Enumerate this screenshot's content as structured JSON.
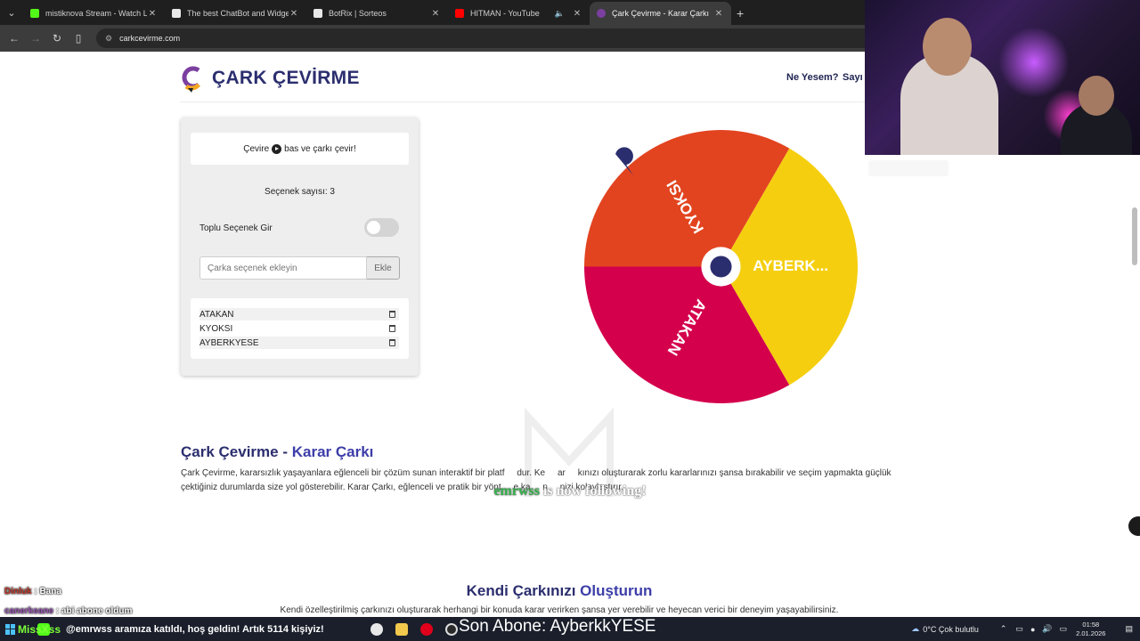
{
  "browser": {
    "tabs": [
      {
        "title": "mistiknova Stream - Watch Live",
        "favicon_color": "#53fc18",
        "active": false,
        "audio": false
      },
      {
        "title": "The best ChatBot and Widgets",
        "favicon_color": "#e8e8e8",
        "active": false,
        "audio": false
      },
      {
        "title": "BotRix | Sorteos",
        "favicon_color": "#e8e8e8",
        "active": false,
        "audio": false
      },
      {
        "title": "HITMAN - YouTube",
        "favicon_color": "#ff0000",
        "active": false,
        "audio": true
      },
      {
        "title": "Çark Çevirme - Karar Çarkı",
        "favicon_color": "#7b3fa0",
        "active": true,
        "audio": false
      }
    ],
    "new_tab_glyph": "+",
    "url": "carkcevirme.com"
  },
  "site": {
    "brand": "ÇARK ÇEVİRME",
    "nav": [
      "Ne Yesem?",
      "Sayı"
    ]
  },
  "panel": {
    "instruction_before": "Çevire",
    "instruction_after": "bas ve çarkı çevir!",
    "option_count_label": "Seçenek sayısı: 3",
    "bulk_label": "Toplu Seçenek Gir",
    "bulk_enabled": false,
    "input_placeholder": "Çarka seçenek ekleyin",
    "add_button": "Ekle",
    "options": [
      "ATAKAN",
      "KYOKSI",
      "AYBERKYESE"
    ]
  },
  "wheel": {
    "segments": [
      {
        "label": "AYBERK...",
        "color": "#f5cf0f"
      },
      {
        "label": "ATAKAN",
        "color": "#d4004c"
      },
      {
        "label": "KYOKSI",
        "color": "#e24420"
      }
    ],
    "center_color": "#2b2e6e",
    "pointer_color": "#2b2e6e"
  },
  "content": {
    "heading1_a": "Çark Çevirme - ",
    "heading1_b": "Karar Çarkı",
    "paragraph1_line1": "Çark Çevirme, kararsızlık yaşayanlara eğlenceli bir çözüm sunan interaktif bir platf     dur. Ke     ar     kınızı oluşturarak zorlu kararlarınızı şansa bırakabilir ve seçim yapmakta güçlük",
    "paragraph1_line2": "çektiğiniz durumlarda size yol gösterebilir. Karar Çarkı, eğlenceli ve pratik bir yönt     e ka     n     nizi kolaylaştırır.",
    "heading2_a": "Kendi Çarkınızı ",
    "heading2_b": "Oluşturun",
    "paragraph2": "Kendi özelleştirilmiş çarkınızı oluşturarak herhangi bir konuda karar verirken şansa yer verebilir ve heyecan verici bir deneyim yaşayabilirsiniz."
  },
  "overlay": {
    "follow_name": "emrwss",
    "follow_text": " is now following!",
    "chat": [
      {
        "user": "Dinluk",
        "text": " : Bana"
      },
      {
        "user": "canerkeane",
        "text": " : abi abone oldum"
      }
    ],
    "ticker_user": "MissXss",
    "ticker": "@emrwss aramıza katıldı, hoş geldin! Artık 5114 kişiyiz!",
    "last_sub": "Son Abone: AyberkkYESE"
  },
  "taskbar": {
    "weather": "0°C  Çok bulutlu",
    "time": "01:58",
    "date": "2.01.2026"
  }
}
